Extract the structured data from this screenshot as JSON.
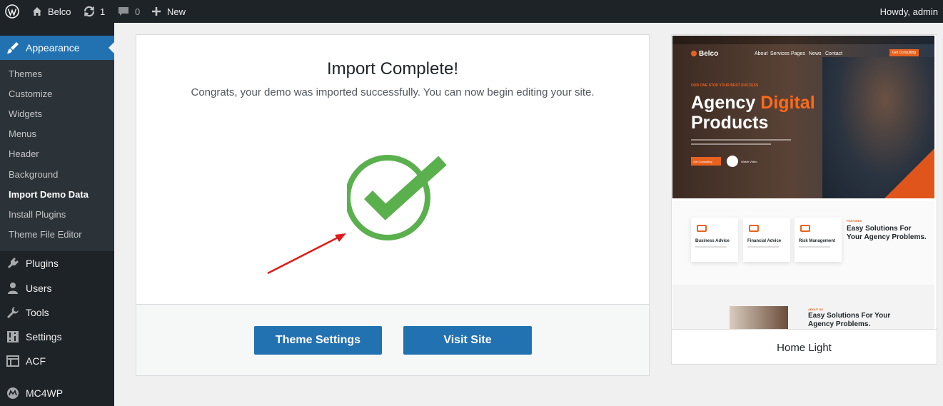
{
  "admin_bar": {
    "site_name": "Belco",
    "updates_count": "1",
    "comments_count": "0",
    "new_label": "New",
    "howdy": "Howdy, admin"
  },
  "sidebar": {
    "current_menu": "Appearance",
    "submenu": [
      "Themes",
      "Customize",
      "Widgets",
      "Menus",
      "Header",
      "Background",
      "Import Demo Data",
      "Install Plugins",
      "Theme File Editor"
    ],
    "active_submenu": "Import Demo Data",
    "menu": [
      {
        "label": "Plugins",
        "icon": "plugin-icon"
      },
      {
        "label": "Users",
        "icon": "users-icon"
      },
      {
        "label": "Tools",
        "icon": "wrench-icon"
      },
      {
        "label": "Settings",
        "icon": "settings-icon"
      },
      {
        "label": "ACF",
        "icon": "acf-icon"
      },
      {
        "label": "MC4WP",
        "icon": "mc4wp-icon"
      }
    ]
  },
  "panel": {
    "title": "Import Complete!",
    "message": "Congrats, your demo was imported successfully. You can now begin editing your site.",
    "buttons": {
      "theme_settings": "Theme Settings",
      "visit_site": "Visit Site"
    },
    "check_color": "#5bb04e",
    "annotation_arrow_color": "#e01b1b"
  },
  "demo": {
    "name": "Home Light",
    "preview": {
      "logo": "Belco",
      "nav": [
        "About",
        "Services",
        "Pages",
        "News",
        "Contact"
      ],
      "cta": "Get Consulting",
      "tagline": "OUR ONE STOP YOUR BEST SUCCESS",
      "headline_part1": "Agency ",
      "headline_highlight": "Digital",
      "headline_part2": "Products",
      "hero_button": "Get Consulting",
      "watch_label": "Watch Video",
      "features": [
        "Business Advice",
        "Financial Advice",
        "Risk Management"
      ],
      "features_tag": "FEATURES",
      "features_title": "Easy Solutions For Your Agency Problems.",
      "about_tag": "ABOUT US",
      "about_title": "Easy Solutions For Your Agency Problems."
    }
  },
  "colors": {
    "admin_bar_bg": "#1d2327",
    "accent": "#2271b1",
    "brand_orange": "#e8621f"
  }
}
